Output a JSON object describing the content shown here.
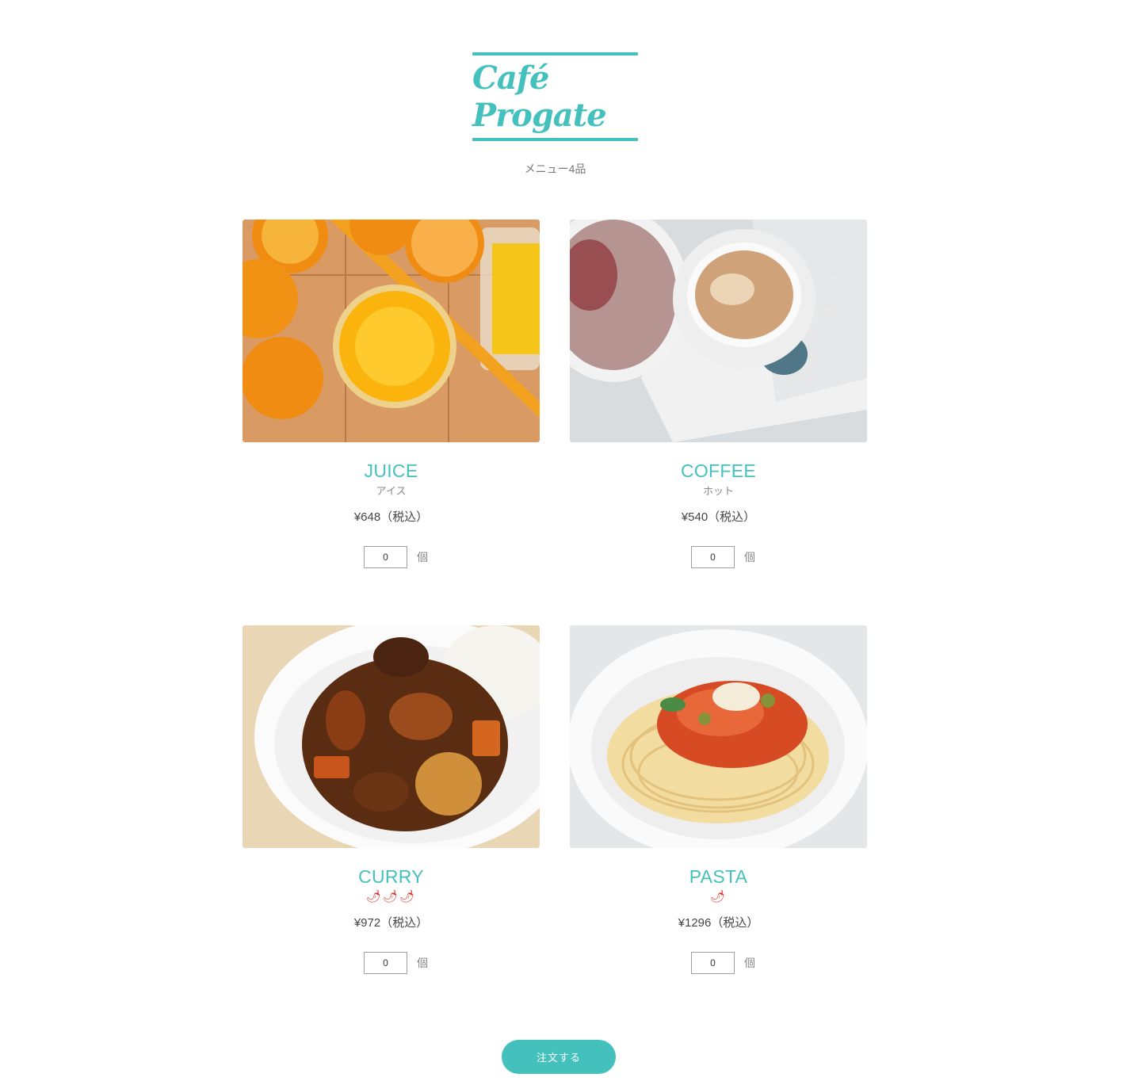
{
  "header": {
    "logo_text": "Café Progate",
    "subtitle": "メニュー4品"
  },
  "menu": {
    "items": [
      {
        "name": "JUICE",
        "sub": "アイス",
        "price": "¥648（税込）",
        "quantity": "0",
        "unit": "個",
        "image": "orange-juice-photo"
      },
      {
        "name": "COFFEE",
        "sub": "ホット",
        "price": "¥540（税込）",
        "quantity": "0",
        "unit": "個",
        "image": "coffee-photo"
      },
      {
        "name": "CURRY",
        "sub": "🌶🌶🌶",
        "spice_level": 3,
        "price": "¥972（税込）",
        "quantity": "0",
        "unit": "個",
        "image": "curry-photo"
      },
      {
        "name": "PASTA",
        "sub": "🌶",
        "spice_level": 1,
        "price": "¥1296（税込）",
        "quantity": "0",
        "unit": "個",
        "image": "pasta-photo"
      }
    ]
  },
  "order_button": {
    "label": "注文する"
  },
  "colors": {
    "accent": "#45c1bd",
    "chili": "#d8322c"
  }
}
